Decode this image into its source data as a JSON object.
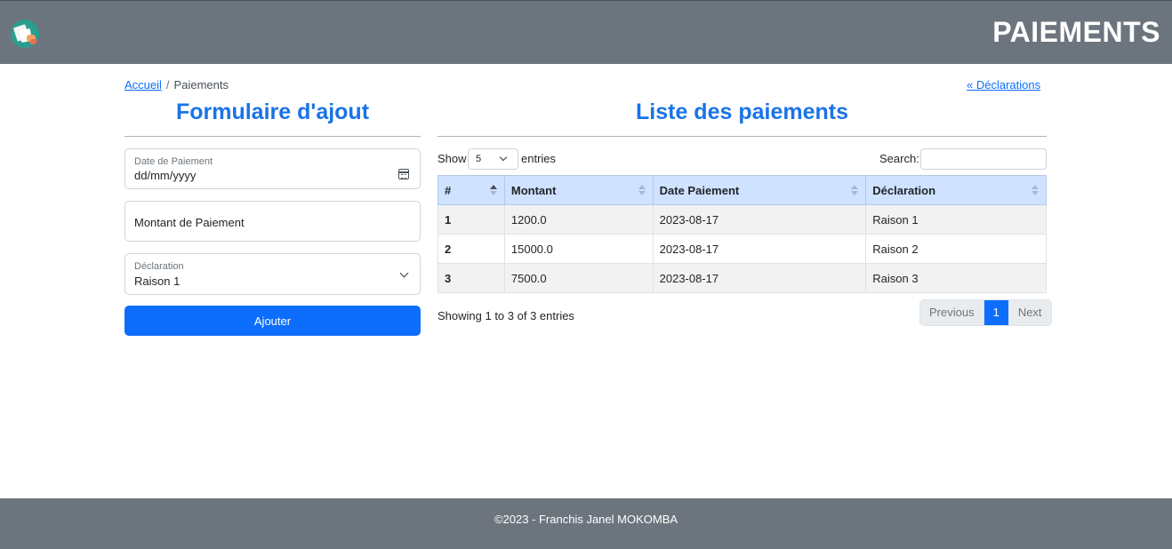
{
  "header": {
    "title": "PAIEMENTS",
    "logo_icon": "payment-document-icon",
    "bg_color": "#6c757d"
  },
  "breadcrumb": {
    "home": "Accueil",
    "separator": "/",
    "current": "Paiements"
  },
  "back_link": "« Déclarations",
  "form": {
    "title": "Formulaire d'ajout",
    "date_label": "Date de Paiement",
    "date_value": "dd/mm/yyyy",
    "amount_placeholder": "Montant de Paiement",
    "declaration_label": "Déclaration",
    "declaration_value": "Raison 1",
    "submit_label": "Ajouter",
    "accent_color": "#0d6efd"
  },
  "list": {
    "title": "Liste des paiements",
    "show_label": "Show",
    "page_length": "5",
    "entries_label": "entries",
    "search_label": "Search:",
    "columns": [
      "#",
      "Montant",
      "Date Paiement",
      "Déclaration"
    ],
    "rows": [
      {
        "id": "1",
        "amount": "1200.0",
        "date": "2023-08-17",
        "declaration": "Raison 1"
      },
      {
        "id": "2",
        "amount": "15000.0",
        "date": "2023-08-17",
        "declaration": "Raison 2"
      },
      {
        "id": "3",
        "amount": "7500.0",
        "date": "2023-08-17",
        "declaration": "Raison 3"
      }
    ],
    "info": "Showing 1 to 3 of 3 entries",
    "pagination": {
      "previous": "Previous",
      "current": "1",
      "next": "Next"
    }
  },
  "footer": {
    "text": "©2023 - Franchis Janel MOKOMBA"
  }
}
